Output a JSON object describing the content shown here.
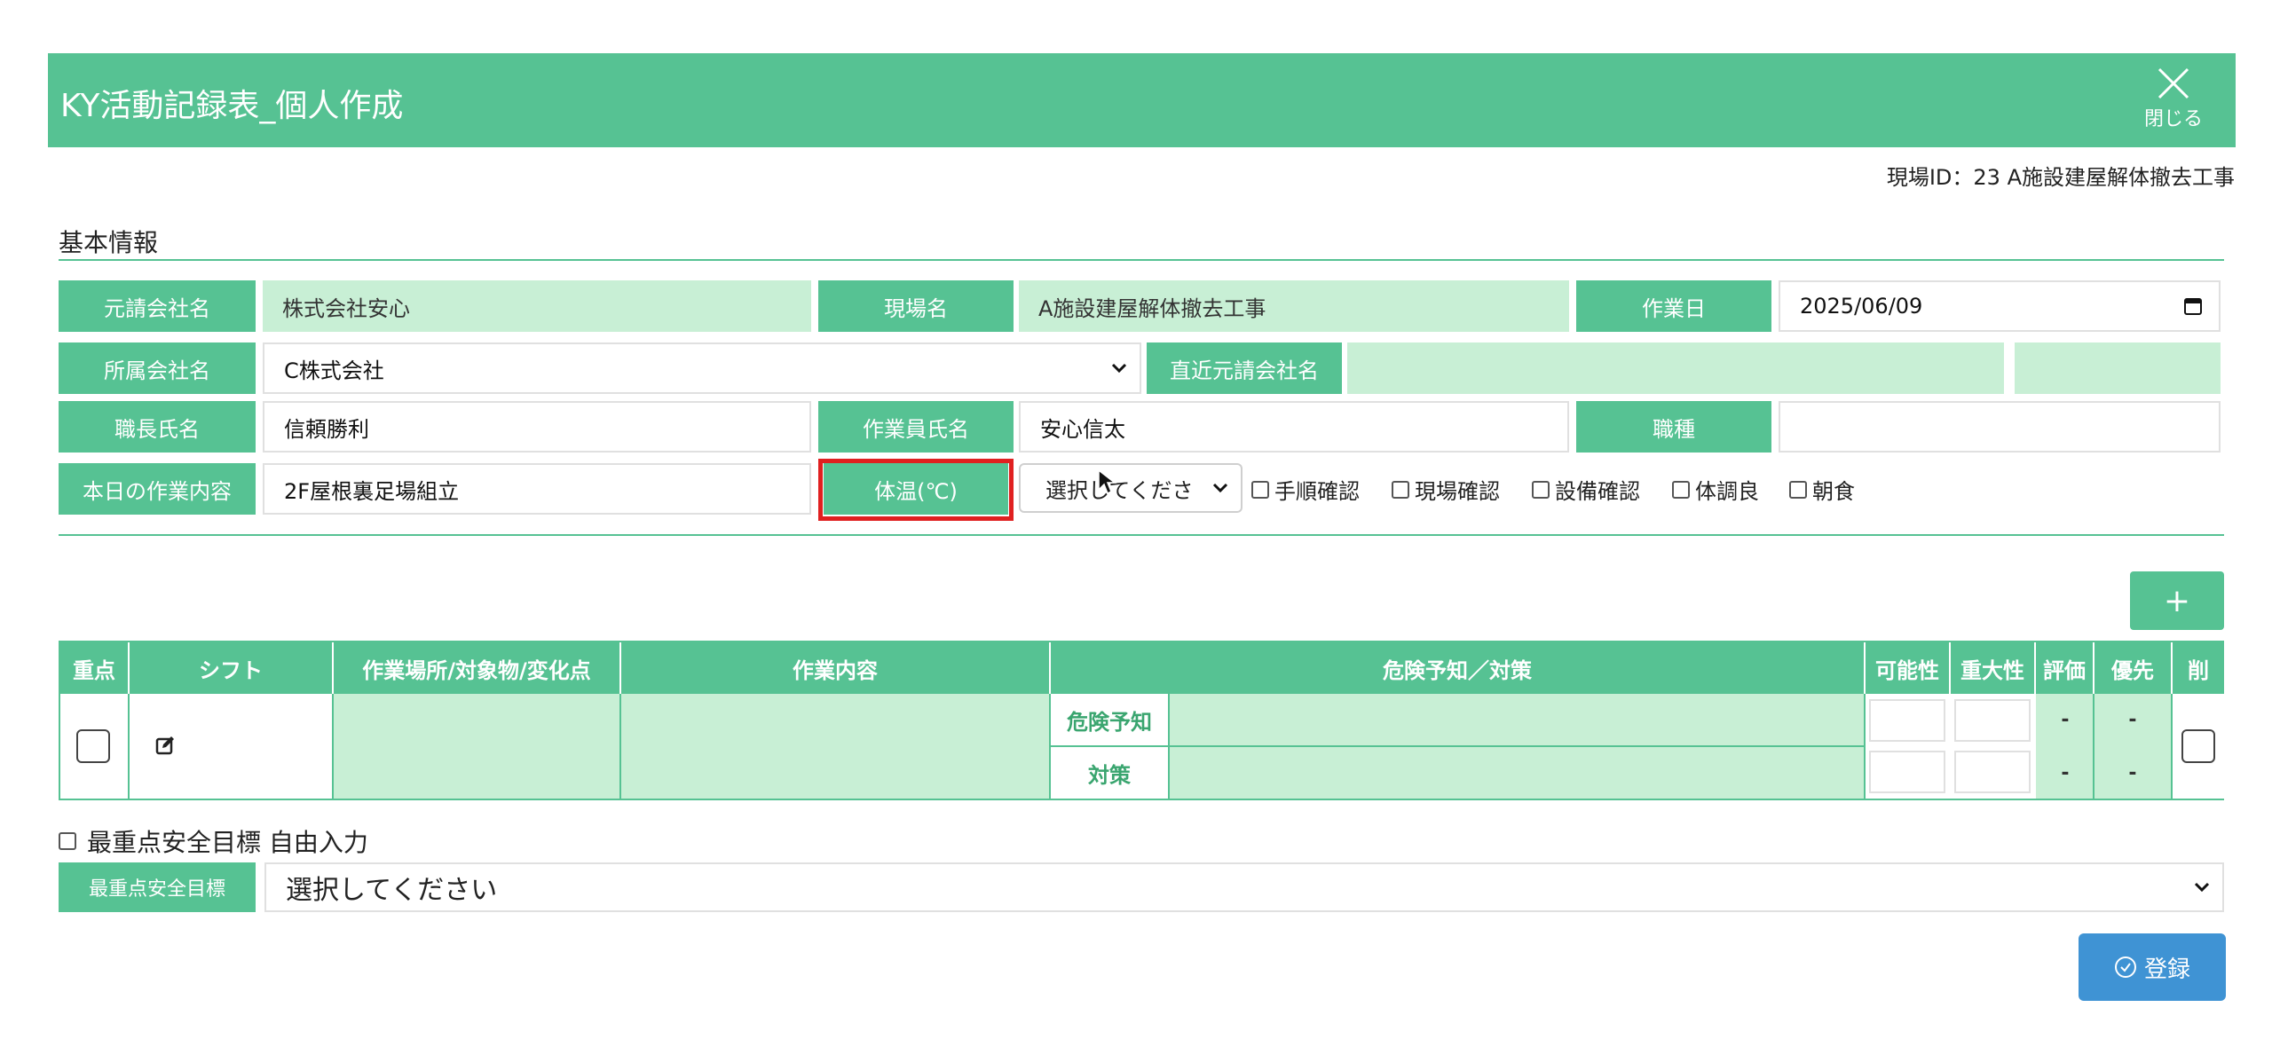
{
  "header": {
    "title": "KY活動記録表_個人作成",
    "close_label": "閉じる"
  },
  "site_id_text": "現場ID：23 A施設建屋解体撤去工事",
  "basic_info": {
    "section_title": "基本情報",
    "prime_company_label": "元請会社名",
    "prime_company_value": "株式会社安心",
    "site_name_label": "現場名",
    "site_name_value": "A施設建屋解体撤去工事",
    "work_date_label": "作業日",
    "work_date_value": "2025/06/09",
    "affiliated_company_label": "所属会社名",
    "affiliated_company_value": "C株式会社",
    "direct_prime_label": "直近元請会社名",
    "direct_prime_value": "",
    "foreman_label": "職長氏名",
    "foreman_value": "信頼勝利",
    "worker_label": "作業員氏名",
    "worker_value": "安心信太",
    "occupation_label": "職種",
    "occupation_value": "",
    "today_work_label": "本日の作業内容",
    "today_work_value": "2F屋根裏足場組立",
    "temperature_label": "体温(℃)",
    "temperature_select": "選択してくださ",
    "checks": [
      "手順確認",
      "現場確認",
      "設備確認",
      "体調良",
      "朝食"
    ]
  },
  "add_button_label": "+",
  "table": {
    "headers": [
      "重点",
      "シフト",
      "作業場所/対象物/変化点",
      "作業内容",
      "危険予知／対策",
      "可能性",
      "重大性",
      "評価",
      "優先",
      "削"
    ],
    "row": {
      "risk_label": "危険予知",
      "measure_label": "対策",
      "eval_risk": "-",
      "prio_risk": "-",
      "eval_measure": "-",
      "prio_measure": "-"
    }
  },
  "free_input_label": "最重点安全目標 自由入力",
  "goal_label": "最重点安全目標",
  "goal_select": "選択してください",
  "submit_label": "登録",
  "colors": {
    "accent": "#56c293",
    "light_accent": "#c8efd5",
    "highlight": "#e02020",
    "submit": "#3f93d4"
  }
}
